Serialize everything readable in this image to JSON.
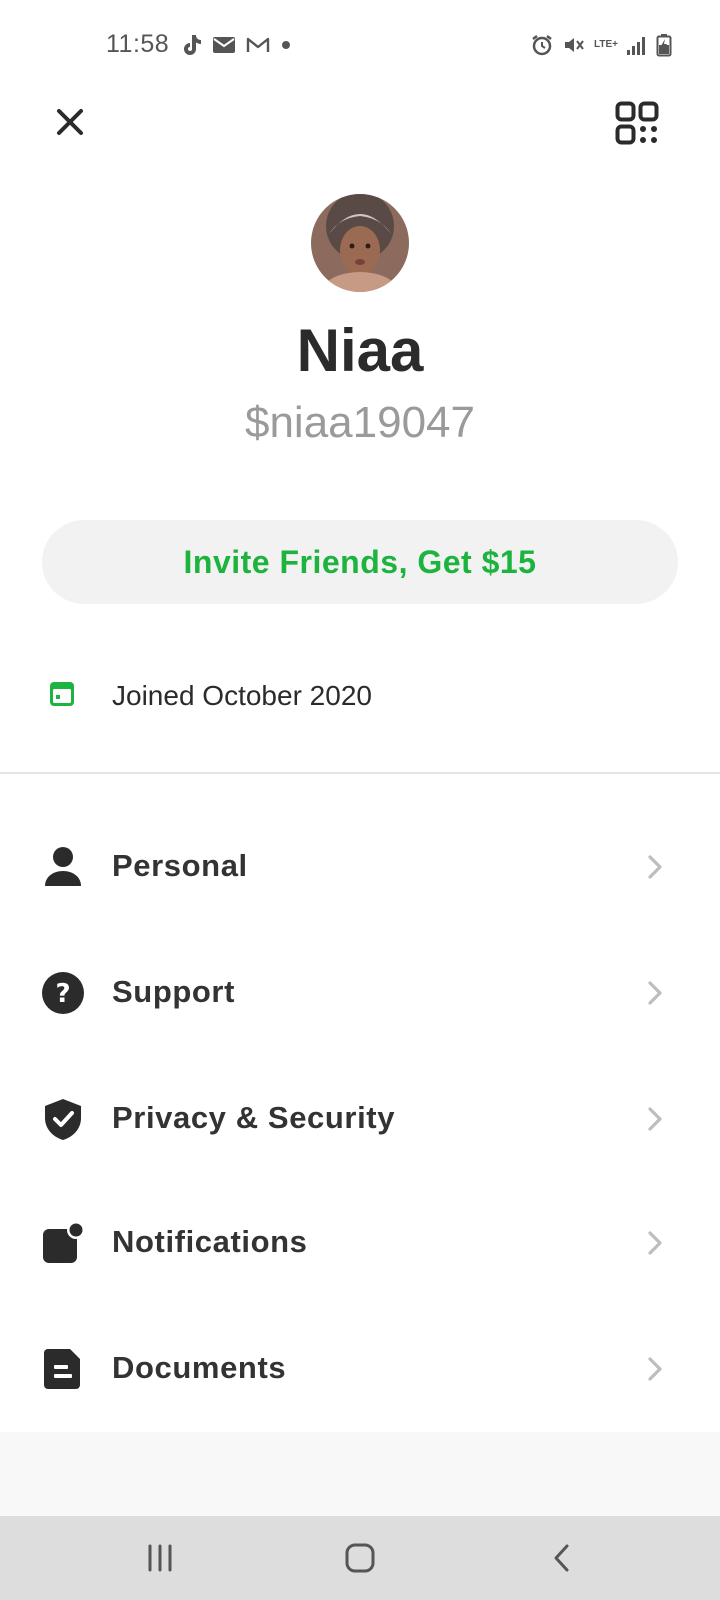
{
  "status_bar": {
    "time": "11:58",
    "left_icons": [
      "tiktok-icon",
      "email-icon",
      "gmail-icon",
      "dot-icon"
    ],
    "right_icons": [
      "alarm-icon",
      "mute-icon",
      "lte-icon",
      "signal-icon",
      "battery-icon"
    ],
    "network_label": "LTE+"
  },
  "header": {
    "close_icon": "close-icon",
    "qr_icon": "qr-code-icon"
  },
  "profile": {
    "name": "Niaa",
    "handle": "$niaa19047"
  },
  "invite": {
    "label": "Invite Friends, Get $15",
    "color": "#1db33f"
  },
  "joined": {
    "label": "Joined October 2020",
    "icon": "calendar-icon",
    "icon_color": "#1db33f"
  },
  "menu": {
    "items": [
      {
        "label": "Personal",
        "icon": "person-icon"
      },
      {
        "label": "Support",
        "icon": "help-icon"
      },
      {
        "label": "Privacy & Security",
        "icon": "shield-check-icon"
      },
      {
        "label": "Notifications",
        "icon": "notification-icon"
      },
      {
        "label": "Documents",
        "icon": "document-icon"
      }
    ]
  },
  "nav_bar": {
    "buttons": [
      "recents-icon",
      "home-icon",
      "back-icon"
    ]
  }
}
